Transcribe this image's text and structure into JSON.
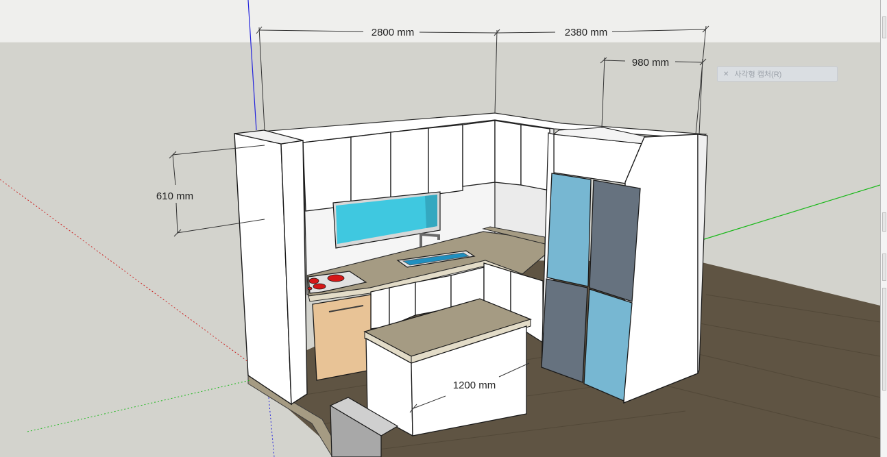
{
  "dimensions": {
    "left_width": "2800 mm",
    "right_width": "2380 mm",
    "fridge_depth": "980 mm",
    "upper_height": "610 mm",
    "island_width": "1200 mm"
  },
  "tooltip": {
    "close_icon": "close-icon",
    "label": "사각형 캡처(R)"
  },
  "colors": {
    "background": "#d3d3cd",
    "floor": "#5f5443",
    "cabinet": "#ffffff",
    "countertop": "#a59b83",
    "window_glass": "#3fc8e0",
    "fridge_light": "#77b7d2",
    "fridge_dark": "#66727f",
    "dishwasher": "#e8c396",
    "cooktop_burner": "#d51818"
  }
}
